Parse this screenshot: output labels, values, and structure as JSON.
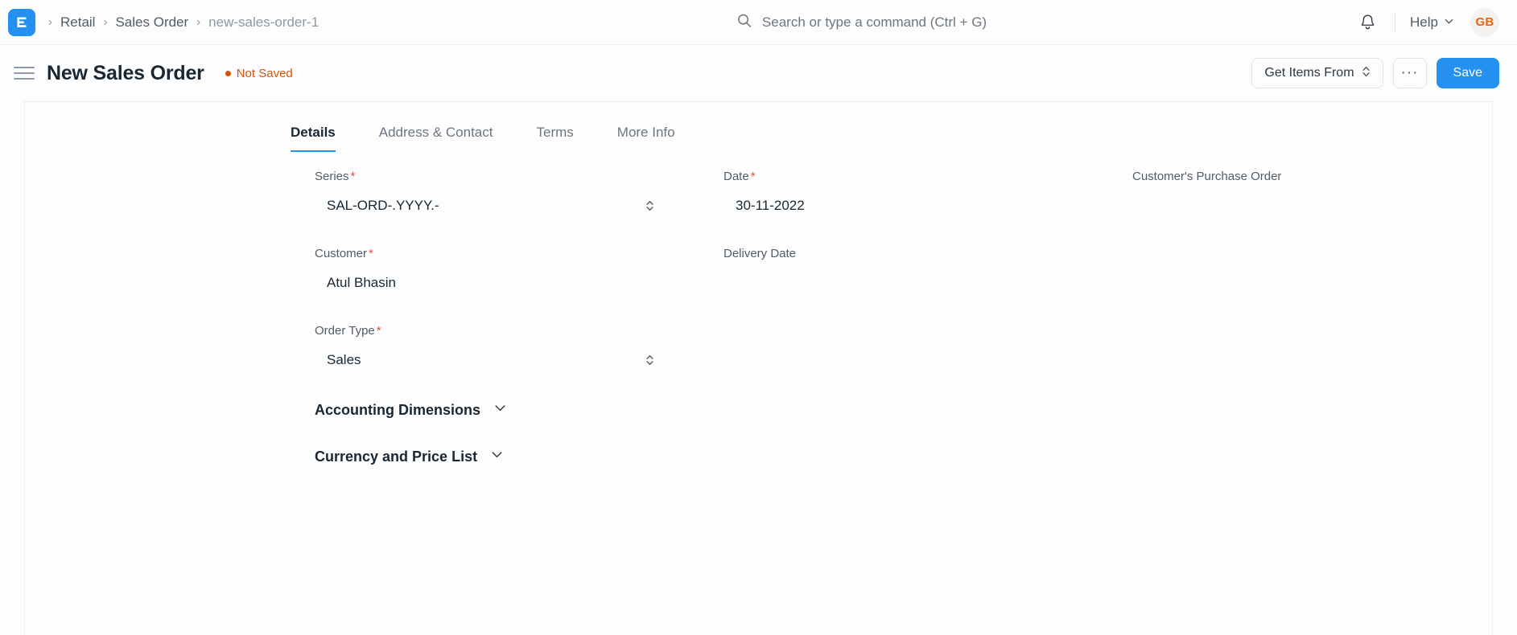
{
  "navbar": {
    "logo_icon": "erpnext-logo-icon",
    "breadcrumb": {
      "separator": "›",
      "items": [
        {
          "label": "Retail",
          "current": false
        },
        {
          "label": "Sales Order",
          "current": false
        },
        {
          "label": "new-sales-order-1",
          "current": true
        }
      ]
    },
    "search": {
      "icon": "search-icon",
      "placeholder": "Search or type a command (Ctrl + G)"
    },
    "notifications_icon": "bell-icon",
    "help": {
      "label": "Help",
      "icon": "chevron-down-icon"
    },
    "avatar": {
      "initials": "GB"
    }
  },
  "page_header": {
    "menu_icon": "hamburger-menu-icon",
    "title": "New Sales Order",
    "status": {
      "label": "Not Saved",
      "color": "#d4530f"
    },
    "actions": {
      "get_items_from": "Get Items From",
      "more_menu": "···",
      "save": "Save"
    }
  },
  "tabs": [
    {
      "label": "Details",
      "active": true
    },
    {
      "label": "Address & Contact",
      "active": false
    },
    {
      "label": "Terms",
      "active": false
    },
    {
      "label": "More Info",
      "active": false
    }
  ],
  "form": {
    "column1": [
      {
        "label": "Series",
        "required": true,
        "value": "SAL-ORD-.YYYY.-",
        "control": "select"
      },
      {
        "label": "Customer",
        "required": true,
        "value": "Atul Bhasin",
        "control": "link"
      },
      {
        "label": "Order Type",
        "required": true,
        "value": "Sales",
        "control": "select"
      }
    ],
    "column2": [
      {
        "label": "Date",
        "required": true,
        "value": "30-11-2022",
        "control": "date"
      },
      {
        "label": "Delivery Date",
        "required": false,
        "value": "",
        "control": "date"
      }
    ],
    "column3": [
      {
        "label": "Customer's Purchase Order",
        "required": false,
        "value": "",
        "control": "text"
      }
    ]
  },
  "sections": [
    {
      "title": "Accounting Dimensions",
      "icon": "chevron-down-icon",
      "collapsed": true
    },
    {
      "title": "Currency and Price List",
      "icon": "chevron-down-icon",
      "collapsed": true
    }
  ],
  "colors": {
    "accent": "#2490ef",
    "status_warning": "#d4530f",
    "required_asterisk": "#e24c4c",
    "avatar_text": "#e8620f",
    "background": "#fdfdfd"
  }
}
